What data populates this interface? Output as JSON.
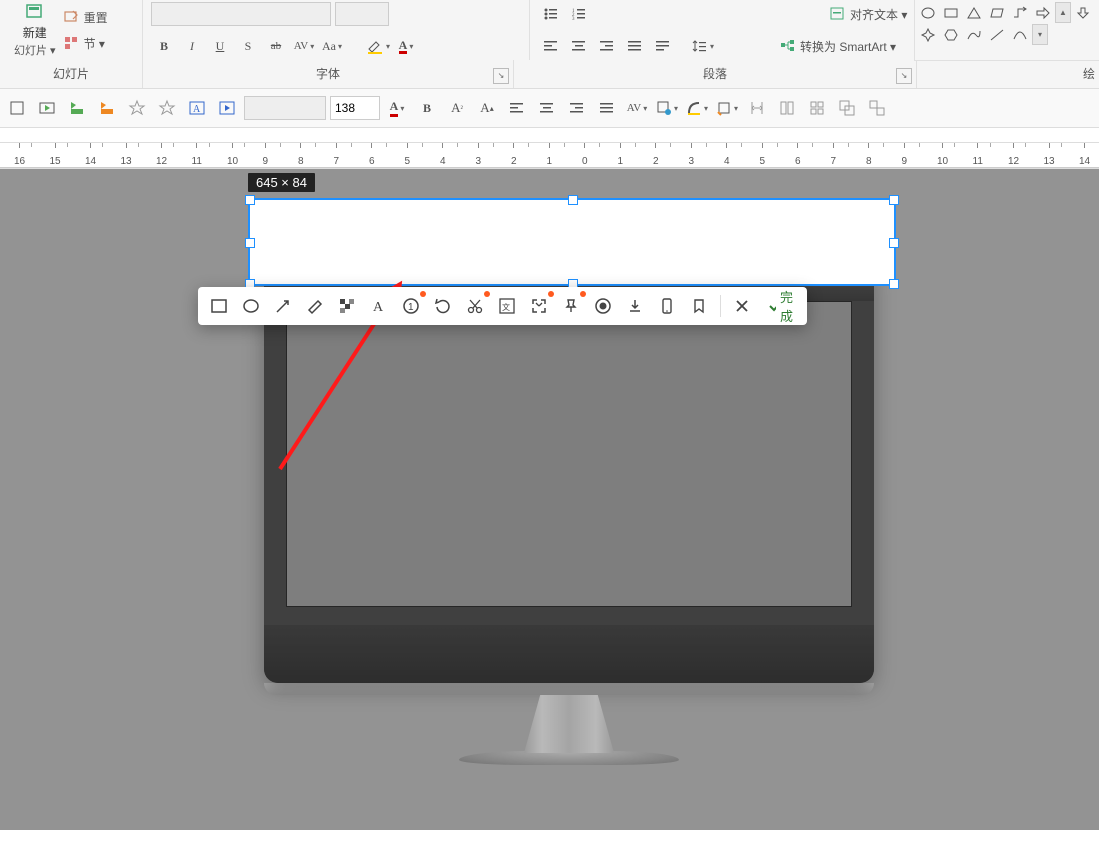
{
  "ribbon": {
    "slide_group": {
      "new_slide": "新建",
      "layout_dd": "幻灯片 ▾",
      "reset": "重置",
      "section": "节 ▾",
      "label": "幻灯片"
    },
    "font_group": {
      "label": "字体",
      "bold": "B",
      "italic": "I",
      "underline": "U",
      "strike": "S",
      "strike2": "ab",
      "spacing": "AV",
      "case": "Aa",
      "fontcolor": "A",
      "highlight": "A"
    },
    "para_group": {
      "label": "段落",
      "align_text": "对齐文本 ▾",
      "smartart": "转换为 SmartArt ▾"
    },
    "draw_group": {
      "label": "绘"
    }
  },
  "toolbar2": {
    "fontsize": "138"
  },
  "ruler": {
    "ticks": [
      16,
      15,
      14,
      13,
      12,
      11,
      10,
      9,
      8,
      7,
      6,
      5,
      4,
      3,
      2,
      1,
      0,
      1,
      2,
      3,
      4,
      5,
      6,
      7,
      8,
      9,
      10,
      11,
      12,
      13,
      14
    ]
  },
  "screenshot": {
    "size_label": "645 × 84",
    "done": "完成",
    "tools": {
      "rect": "rect-icon",
      "ellipse": "ellipse-icon",
      "arrow": "arrow-icon",
      "pen": "pen-icon",
      "mosaic": "mosaic-icon",
      "text": "text-icon",
      "numbered": "number-icon",
      "undo": "undo-icon",
      "cut": "scissors-icon",
      "ocr": "ocr-icon",
      "fullscreen": "fullscreen-icon",
      "pin": "pin-icon",
      "record": "record-icon",
      "download": "download-icon",
      "phone": "phone-icon",
      "bookmark": "bookmark-icon",
      "close": "close-icon",
      "confirm": "check-icon"
    }
  }
}
